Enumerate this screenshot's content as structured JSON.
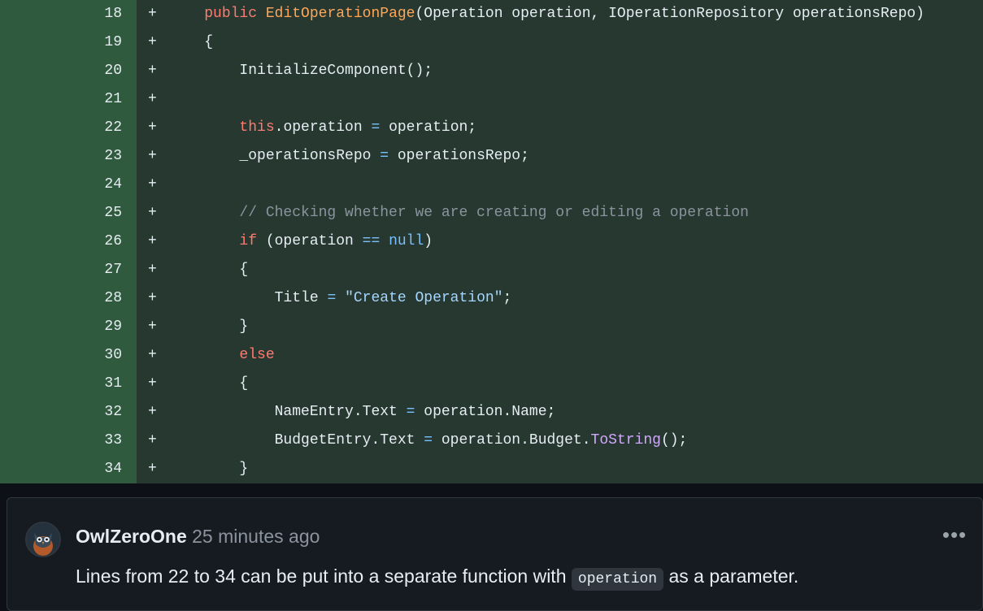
{
  "diff": {
    "lines": [
      {
        "n": "18",
        "marker": "+",
        "tokens": [
          {
            "t": "    "
          },
          {
            "t": "public ",
            "c": "k"
          },
          {
            "t": "EditOperationPage",
            "c": "f"
          },
          {
            "t": "(Operation operation, IOperationRepository operationsRepo)",
            "c": "p"
          }
        ]
      },
      {
        "n": "19",
        "marker": "+",
        "tokens": [
          {
            "t": "    {",
            "c": "p"
          }
        ]
      },
      {
        "n": "20",
        "marker": "+",
        "tokens": [
          {
            "t": "        InitializeComponent();",
            "c": "p"
          }
        ]
      },
      {
        "n": "21",
        "marker": "+",
        "tokens": []
      },
      {
        "n": "22",
        "marker": "+",
        "tokens": [
          {
            "t": "        "
          },
          {
            "t": "this",
            "c": "k"
          },
          {
            "t": ".operation ",
            "c": "p"
          },
          {
            "t": "=",
            "c": "o"
          },
          {
            "t": " operation;",
            "c": "p"
          }
        ]
      },
      {
        "n": "23",
        "marker": "+",
        "tokens": [
          {
            "t": "        _operationsRepo ",
            "c": "p"
          },
          {
            "t": "=",
            "c": "o"
          },
          {
            "t": " operationsRepo;",
            "c": "p"
          }
        ]
      },
      {
        "n": "24",
        "marker": "+",
        "tokens": []
      },
      {
        "n": "25",
        "marker": "+",
        "tokens": [
          {
            "t": "        // Checking whether we are creating or editing a operation",
            "c": "c"
          }
        ]
      },
      {
        "n": "26",
        "marker": "+",
        "tokens": [
          {
            "t": "        "
          },
          {
            "t": "if",
            "c": "k"
          },
          {
            "t": " (operation ",
            "c": "p"
          },
          {
            "t": "==",
            "c": "o"
          },
          {
            "t": " ",
            "c": "p"
          },
          {
            "t": "null",
            "c": "o"
          },
          {
            "t": ")",
            "c": "p"
          }
        ]
      },
      {
        "n": "27",
        "marker": "+",
        "tokens": [
          {
            "t": "        {",
            "c": "p"
          }
        ]
      },
      {
        "n": "28",
        "marker": "+",
        "tokens": [
          {
            "t": "            Title ",
            "c": "p"
          },
          {
            "t": "=",
            "c": "o"
          },
          {
            "t": " ",
            "c": "p"
          },
          {
            "t": "\"Create Operation\"",
            "c": "s"
          },
          {
            "t": ";",
            "c": "p"
          }
        ]
      },
      {
        "n": "29",
        "marker": "+",
        "tokens": [
          {
            "t": "        }",
            "c": "p"
          }
        ]
      },
      {
        "n": "30",
        "marker": "+",
        "tokens": [
          {
            "t": "        "
          },
          {
            "t": "else",
            "c": "k"
          }
        ]
      },
      {
        "n": "31",
        "marker": "+",
        "tokens": [
          {
            "t": "        {",
            "c": "p"
          }
        ]
      },
      {
        "n": "32",
        "marker": "+",
        "tokens": [
          {
            "t": "            NameEntry.Text ",
            "c": "p"
          },
          {
            "t": "=",
            "c": "o"
          },
          {
            "t": " operation.Name;",
            "c": "p"
          }
        ]
      },
      {
        "n": "33",
        "marker": "+",
        "tokens": [
          {
            "t": "            BudgetEntry.Text ",
            "c": "p"
          },
          {
            "t": "=",
            "c": "o"
          },
          {
            "t": " operation.Budget.",
            "c": "p"
          },
          {
            "t": "ToString",
            "c": "m"
          },
          {
            "t": "();",
            "c": "p"
          }
        ]
      },
      {
        "n": "34",
        "marker": "+",
        "tokens": [
          {
            "t": "        }",
            "c": "p"
          }
        ]
      }
    ]
  },
  "comment": {
    "author": "OwlZeroOne",
    "timestamp": "25 minutes ago",
    "more_label": "•••",
    "body_before": "Lines from 22 to 34 can be put into a separate function with ",
    "body_code": "operation",
    "body_after": " as a parameter."
  },
  "colors": {
    "line_number_bg": "#2f5a3d",
    "code_bg": "#26382f",
    "keyword": "#ff7b72",
    "function": "#ffa657",
    "method": "#d2a8ff",
    "operator": "#79c0ff",
    "comment": "#8b949e",
    "string": "#a5d6ff"
  },
  "icons": {
    "avatar": "owl-avatar-icon",
    "more": "kebab-horizontal-icon"
  }
}
